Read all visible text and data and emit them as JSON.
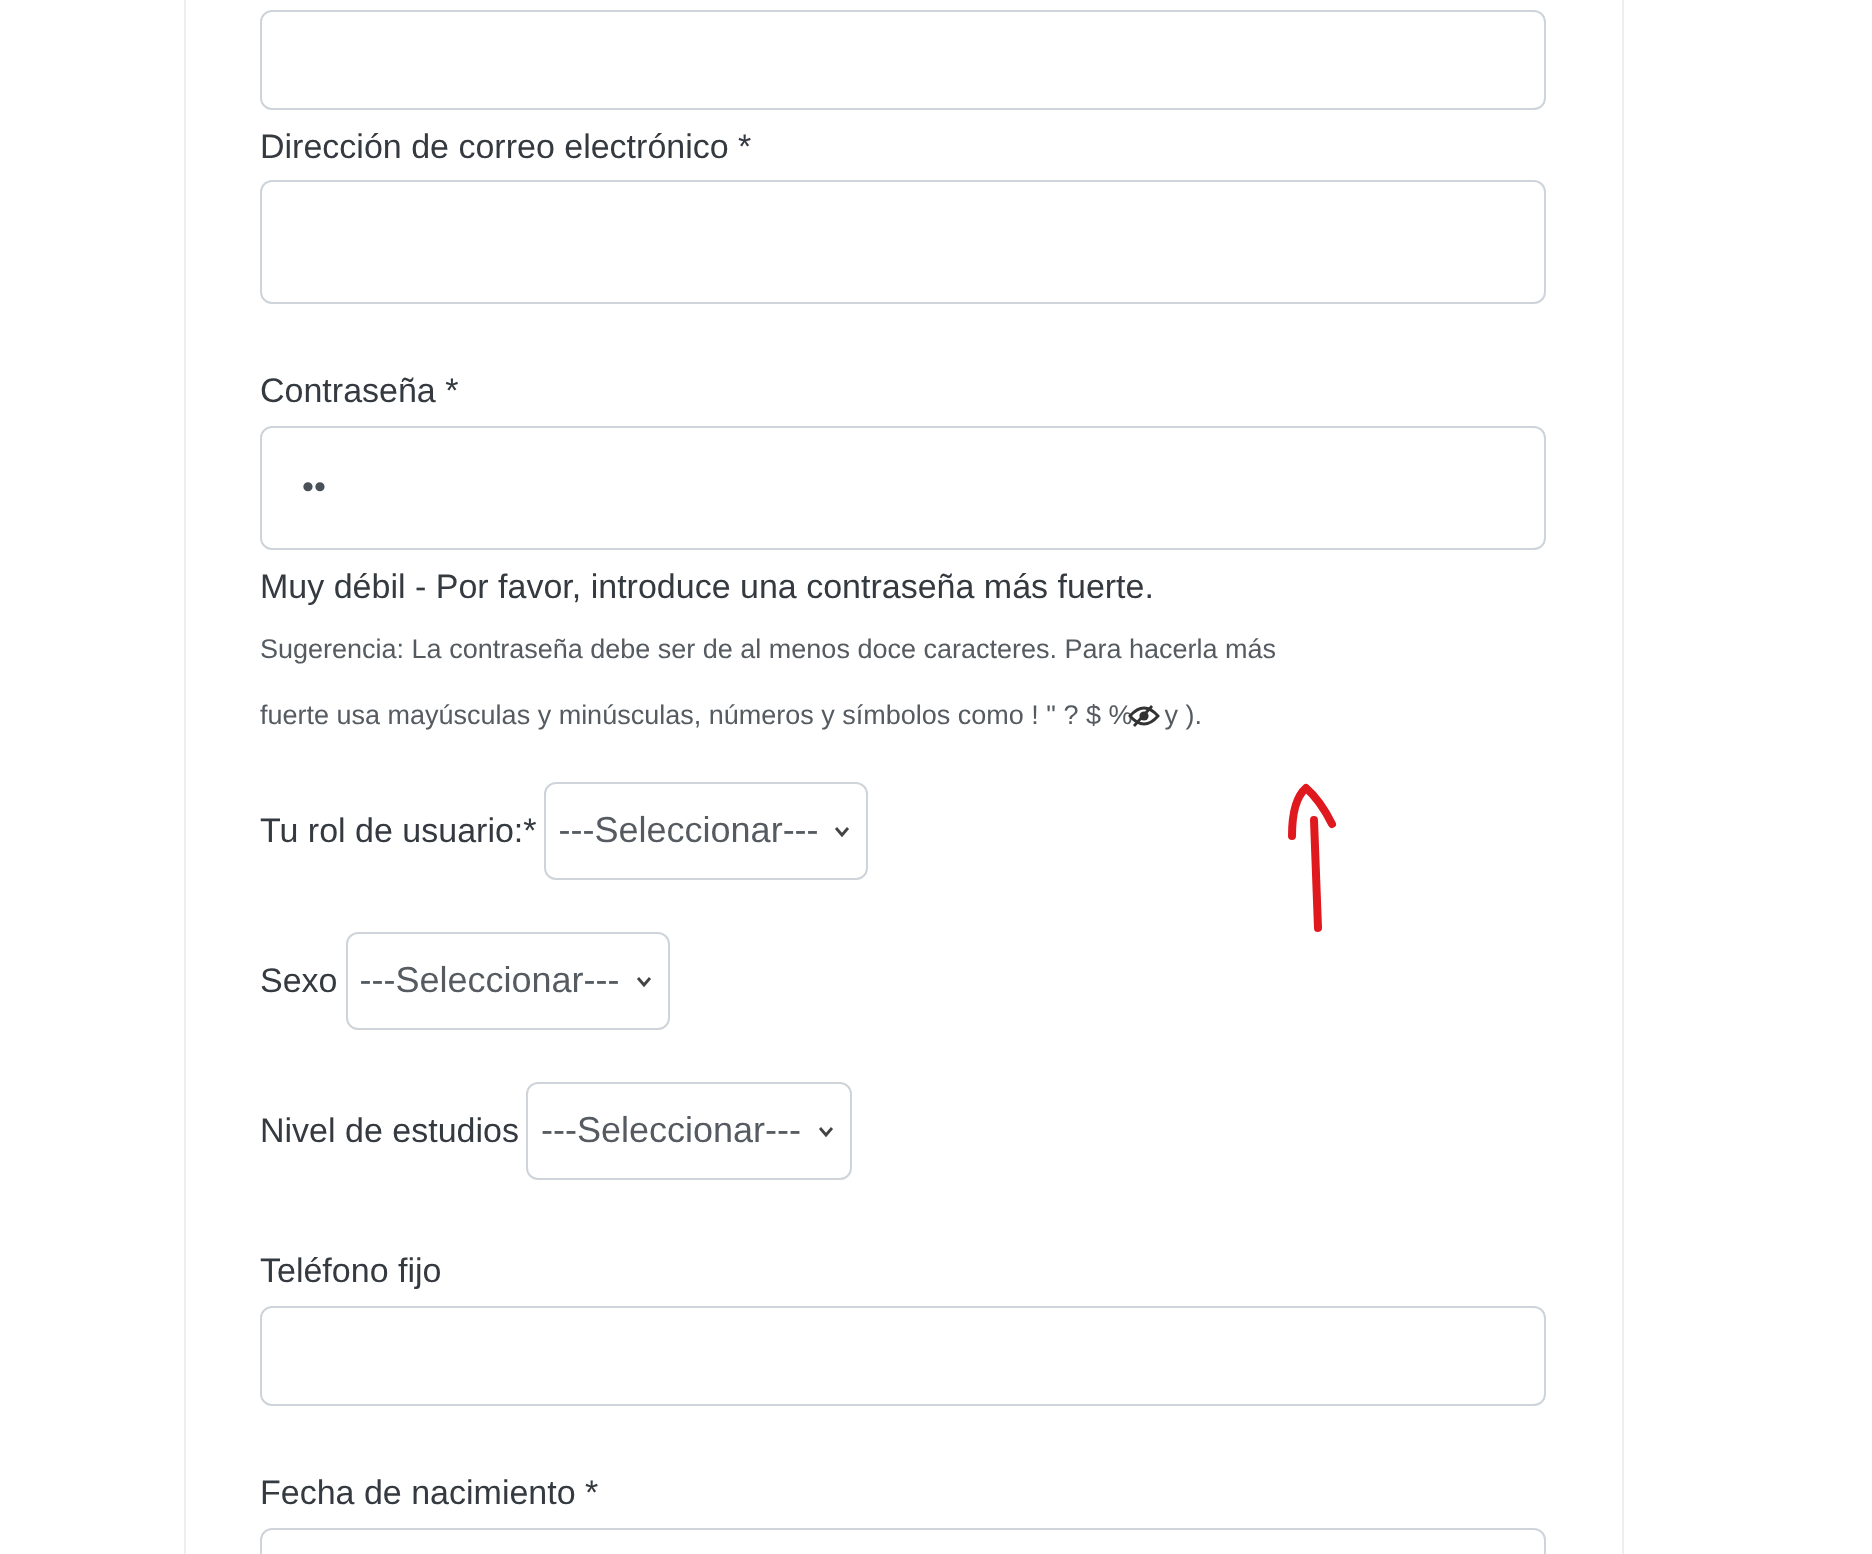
{
  "email": {
    "label": "Dirección de correo electrónico *"
  },
  "password": {
    "label": "Contraseña *",
    "value": "••"
  },
  "strength": "Muy débil - Por favor, introduce una contraseña más fuerte.",
  "hint_line_1": "Sugerencia: La contraseña debe ser de al menos doce caracteres. Para hacerla más",
  "hint_line_2_before": "fuerte usa mayúsculas y minúsculas, números y símbolos como ! \" ? $ %",
  "hint_line_2_after": "y ).",
  "selects": [
    {
      "label": "Tu rol de usuario:*",
      "value": "---Seleccionar---"
    },
    {
      "label": "Sexo",
      "value": "---Seleccionar---"
    },
    {
      "label": "Nivel de estudios",
      "value": "---Seleccionar---"
    }
  ],
  "phone": {
    "label": "Teléfono fijo"
  },
  "birth": {
    "label": "Fecha de nacimiento *"
  }
}
